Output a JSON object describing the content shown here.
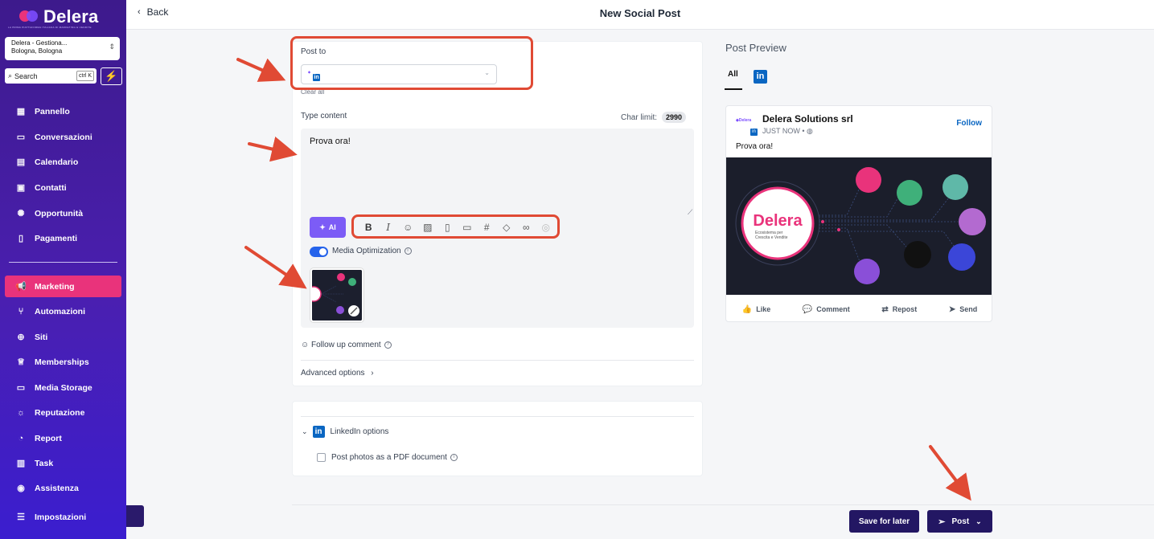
{
  "brand": {
    "name": "Delera",
    "tagline": "LA PRIMA PIATTAFORMA ITALIANA DI MARKETING E VENDITE"
  },
  "sidebar": {
    "location": {
      "line1": "Delera - Gestiona...",
      "line2": "Bologna, Bologna"
    },
    "search": {
      "label": "Search",
      "shortcut": "ctrl K"
    },
    "items": [
      {
        "label": "Pannello",
        "icon": "dashboard-icon"
      },
      {
        "label": "Conversazioni",
        "icon": "chat-icon"
      },
      {
        "label": "Calendario",
        "icon": "calendar-icon"
      },
      {
        "label": "Contatti",
        "icon": "contacts-icon"
      },
      {
        "label": "Opportunità",
        "icon": "lightbulb-icon"
      },
      {
        "label": "Pagamenti",
        "icon": "payments-icon"
      },
      {
        "label": "Marketing",
        "icon": "megaphone-icon",
        "active": true
      },
      {
        "label": "Automazioni",
        "icon": "automation-icon"
      },
      {
        "label": "Siti",
        "icon": "globe-icon"
      },
      {
        "label": "Memberships",
        "icon": "crown-icon"
      },
      {
        "label": "Media Storage",
        "icon": "storage-icon"
      },
      {
        "label": "Reputazione",
        "icon": "star-icon"
      },
      {
        "label": "Report",
        "icon": "report-icon"
      },
      {
        "label": "Task",
        "icon": "task-icon"
      },
      {
        "label": "Assistenza",
        "icon": "headset-icon"
      },
      {
        "label": "Impostazioni",
        "icon": "settings-icon"
      }
    ]
  },
  "header": {
    "back_label": "Back",
    "title": "New Social Post"
  },
  "composer": {
    "post_to_label": "Post to",
    "clear_all": "Clear all",
    "type_content_label": "Type content",
    "char_limit_label": "Char limit:",
    "char_limit_value": "2990",
    "content": "Prova ora!",
    "ai_label": "AI",
    "toolbar": [
      "bold-icon",
      "italic-icon",
      "emoji-icon",
      "image-icon",
      "file-icon",
      "video-icon",
      "hashtag-icon",
      "tag-icon",
      "link-icon",
      "user-icon"
    ],
    "media_optimization_label": "Media Optimization",
    "media_optimization_on": true,
    "follow_up_label": "Follow up comment",
    "advanced_label": "Advanced options"
  },
  "linkedin_options": {
    "title": "LinkedIn options",
    "pdf_label": "Post photos as a PDF document",
    "pdf_checked": false
  },
  "preview": {
    "title": "Post Preview",
    "tab_all": "All",
    "account_name": "Delera Solutions srl",
    "timestamp": "JUST NOW •",
    "follow": "Follow",
    "text": "Prova ora!",
    "image": {
      "brand": "Delera",
      "subtitle_line1": "Ecosistema per",
      "subtitle_line2": "Crescita e Vendite"
    },
    "actions": {
      "like": "Like",
      "comment": "Comment",
      "repost": "Repost",
      "send": "Send"
    }
  },
  "footer": {
    "save_label": "Save for later",
    "post_label": "Post"
  },
  "colors": {
    "sidebar": "#3d1a8c",
    "active": "#e9337b",
    "primary_button": "#231763",
    "annotation": "#e04a34",
    "linkedin": "#0a66c2"
  }
}
